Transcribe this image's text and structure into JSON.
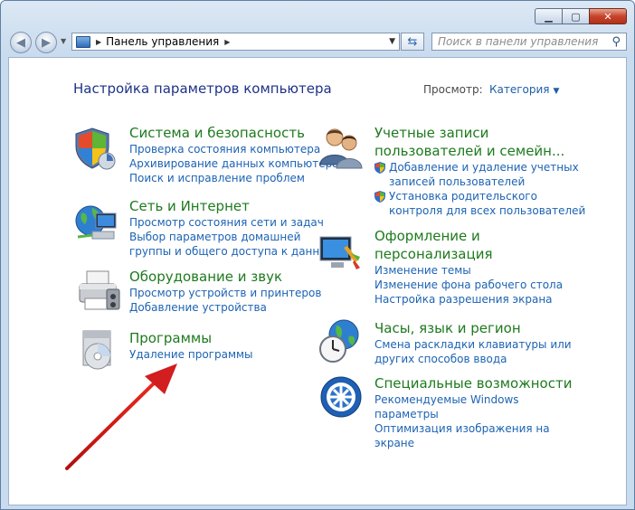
{
  "address": {
    "crumb": "Панель управления"
  },
  "search": {
    "placeholder": "Поиск в панели управления"
  },
  "header": {
    "title": "Настройка параметров компьютера",
    "view_label": "Просмотр:",
    "view_value": "Категория"
  },
  "left": [
    {
      "title": "Система и безопасность",
      "icon": "shield-icon",
      "links": [
        "Проверка состояния компьютера",
        "Архивирование данных компьютера",
        "Поиск и исправление проблем"
      ]
    },
    {
      "title": "Сеть и Интернет",
      "icon": "network-globe-icon",
      "links": [
        "Просмотр состояния сети и задач",
        "Выбор параметров домашней",
        "группы и общего доступа к данным"
      ]
    },
    {
      "title": "Оборудование и звук",
      "icon": "printer-icon",
      "links": [
        "Просмотр устройств и принтеров",
        "Добавление устройства"
      ]
    },
    {
      "title": "Программы",
      "icon": "programs-icon",
      "links": [
        "Удаление программы"
      ]
    }
  ],
  "right": [
    {
      "title_lines": [
        "Учетные записи",
        "пользователей и семейн..."
      ],
      "icon": "users-icon",
      "links": [
        "Добавление и удаление учетных",
        "записей пользователей",
        "Установка родительского",
        "контроля для всех пользователей"
      ]
    },
    {
      "title_lines": [
        "Оформление и",
        "персонализация"
      ],
      "icon": "display-brush-icon",
      "links": [
        "Изменение темы",
        "Изменение фона рабочего стола",
        "Настройка разрешения экрана"
      ]
    },
    {
      "title_lines": [
        "Часы, язык и регион"
      ],
      "icon": "clock-globe-icon",
      "links": [
        "Смена раскладки клавиатуры или",
        "других способов ввода"
      ]
    },
    {
      "title_lines": [
        "Специальные возможности"
      ],
      "icon": "accessibility-icon",
      "links": [
        "Рекомендуемые Windows",
        "параметры",
        "Оптимизация изображения на",
        "экране"
      ]
    }
  ],
  "colors": {
    "title_green": "#1e7a1e",
    "link_blue": "#1d63b3",
    "heading_blue": "#1e3287",
    "arrow_red": "#d21e1e"
  }
}
